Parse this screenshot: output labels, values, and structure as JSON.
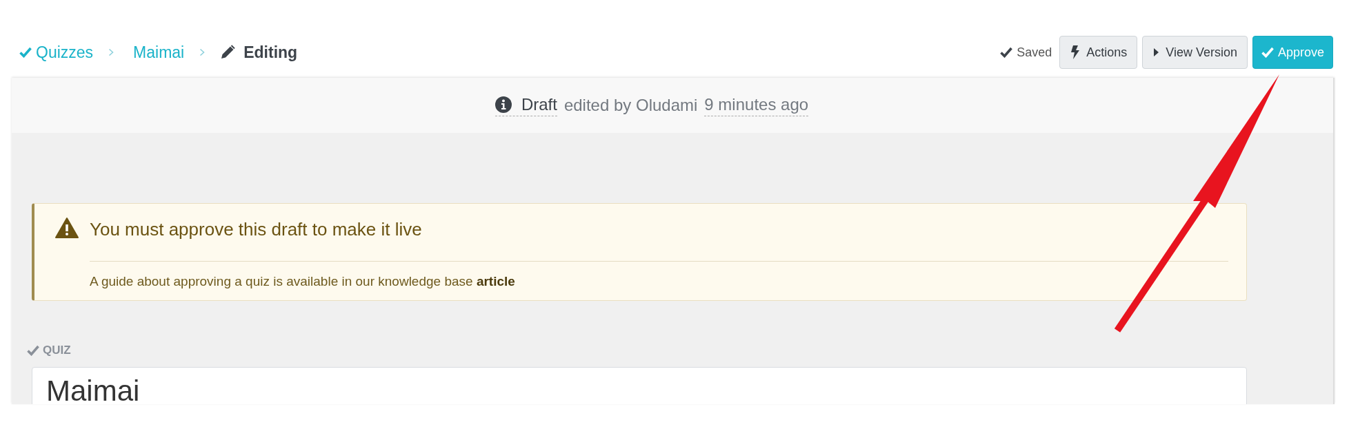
{
  "breadcrumbs": [
    {
      "label": "Quizzes",
      "kind": "link"
    },
    {
      "label": "Maimai",
      "kind": "link"
    },
    {
      "label": "Editing",
      "kind": "current"
    }
  ],
  "save_status": "Saved",
  "buttons": [
    {
      "label": "Actions",
      "kind": "default"
    },
    {
      "label": "View Version",
      "kind": "default"
    },
    {
      "label": "Approve",
      "kind": "primary"
    }
  ],
  "status": {
    "state": "Draft",
    "editor_text": "edited by Oludami",
    "time": "9 minutes ago"
  },
  "alert": {
    "title": "You must approve this draft to make it live",
    "message": "A guide about approving a quiz is available in our knowledge base **article**"
  },
  "quiz_field": {
    "label": "QUIZ",
    "value": "Maimai"
  }
}
